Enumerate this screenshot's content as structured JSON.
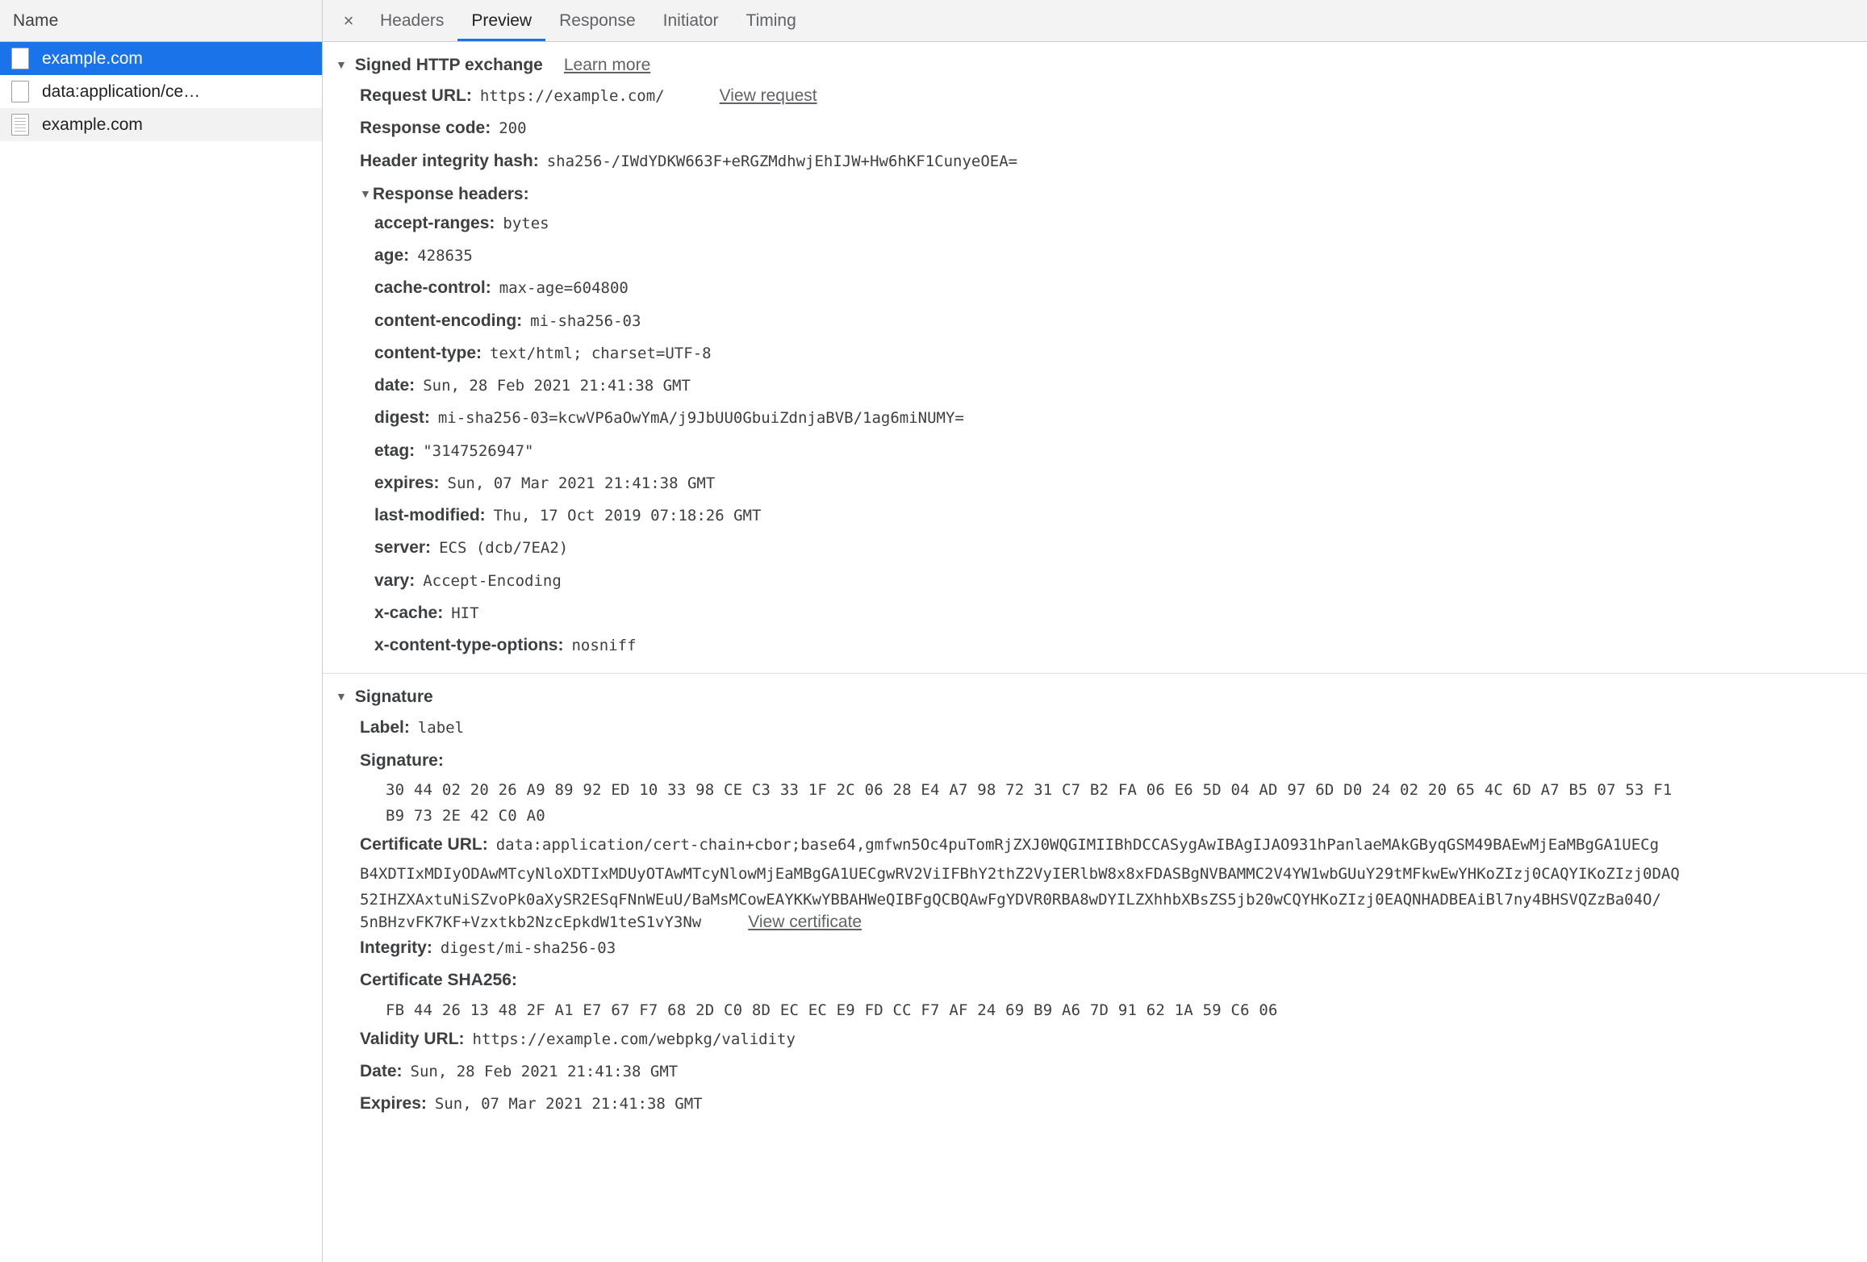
{
  "sidebar": {
    "column_header": "Name",
    "rows": [
      {
        "label": "example.com",
        "icon": "page-icon",
        "selected": true
      },
      {
        "label": "data:application/ce…",
        "icon": "page-icon",
        "selected": false
      },
      {
        "label": "example.com",
        "icon": "document-icon",
        "selected": false
      }
    ]
  },
  "tabs": {
    "close_label": "×",
    "items": [
      {
        "label": "Headers",
        "active": false
      },
      {
        "label": "Preview",
        "active": true
      },
      {
        "label": "Response",
        "active": false
      },
      {
        "label": "Initiator",
        "active": false
      },
      {
        "label": "Timing",
        "active": false
      }
    ]
  },
  "sxg": {
    "title": "Signed HTTP exchange",
    "learn_more": "Learn more",
    "request_url_key": "Request URL:",
    "request_url_val": "https://example.com/",
    "view_request": "View request",
    "response_code_key": "Response code:",
    "response_code_val": "200",
    "header_integrity_key": "Header integrity hash:",
    "header_integrity_val": "sha256-/IWdYDKW663F+eRGZMdhwjEhIJW+Hw6hKF1CunyeOEA=",
    "response_headers_title": "Response headers:",
    "headers": [
      {
        "name": "accept-ranges:",
        "value": "bytes"
      },
      {
        "name": "age:",
        "value": "428635"
      },
      {
        "name": "cache-control:",
        "value": "max-age=604800"
      },
      {
        "name": "content-encoding:",
        "value": "mi-sha256-03"
      },
      {
        "name": "content-type:",
        "value": "text/html; charset=UTF-8"
      },
      {
        "name": "date:",
        "value": "Sun, 28 Feb 2021 21:41:38 GMT"
      },
      {
        "name": "digest:",
        "value": "mi-sha256-03=kcwVP6aOwYmA/j9JbUU0GbuiZdnjaBVB/1ag6miNUMY="
      },
      {
        "name": "etag:",
        "value": "\"3147526947\""
      },
      {
        "name": "expires:",
        "value": "Sun, 07 Mar 2021 21:41:38 GMT"
      },
      {
        "name": "last-modified:",
        "value": "Thu, 17 Oct 2019 07:18:26 GMT"
      },
      {
        "name": "server:",
        "value": "ECS (dcb/7EA2)"
      },
      {
        "name": "vary:",
        "value": "Accept-Encoding"
      },
      {
        "name": "x-cache:",
        "value": "HIT"
      },
      {
        "name": "x-content-type-options:",
        "value": "nosniff"
      }
    ]
  },
  "signature": {
    "title": "Signature",
    "label_key": "Label:",
    "label_val": "label",
    "signature_key": "Signature:",
    "signature_bytes_line1": "30 44 02 20 26 A9 89 92 ED 10 33 98 CE C3 33 1F 2C 06 28 E4 A7 98 72 31 C7 B2 FA 06 E6 5D 04 AD 97 6D D0 24 02 20 65 4C 6D A7 B5 07 53 F1",
    "signature_bytes_line2": "B9 73 2E 42 C0 A0",
    "certificate_url_key": "Certificate URL:",
    "certificate_url_lines": [
      "data:application/cert-chain+cbor;base64,gmfwn5Oc4puTomRjZXJ0WQGIMIIBhDCCASygAwIBAgIJAO931hPanlaeMAkGByqGSM49BAEwMjEaMBgGA1UECg",
      "B4XDTIxMDIyODAwMTcyNloXDTIxMDUyOTAwMTcyNlowMjEaMBgGA1UECgwRV2ViIFBhY2thZ2VyIERlbW8x8xFDASBgNVBAMMC2V4YW1wbGUuY29tMFkwEwYHKoZIzj0CAQYIKoZIzj0DAQ",
      "52IHZXAxtuNiSZvoPk0aXySR2ESqFNnWEuU/BaMsMCowEAYKKwYBBAHWeQIBFgQCBQAwFgYDVR0RBA8wDYILZXhhbXBsZS5jb20wCQYHKoZIzj0EAQNHADBEAiBl7ny4BHSVQZzBa04O/",
      "5nBHzvFK7KF+Vzxtkb2NzcEpkdW1teS1vY3Nw"
    ],
    "view_certificate": "View certificate",
    "integrity_key": "Integrity:",
    "integrity_val": "digest/mi-sha256-03",
    "cert_sha256_key": "Certificate SHA256:",
    "cert_sha256_val": "FB 44 26 13 48 2F A1 E7 67 F7 68 2D C0 8D EC EC E9 FD CC F7 AF 24 69 B9 A6 7D 91 62 1A 59 C6 06",
    "validity_url_key": "Validity URL:",
    "validity_url_val": "https://example.com/webpkg/validity",
    "date_key": "Date:",
    "date_val": "Sun, 28 Feb 2021 21:41:38 GMT",
    "expires_key": "Expires:",
    "expires_val": "Sun, 07 Mar 2021 21:41:38 GMT"
  },
  "colors": {
    "accent": "#1a73e8",
    "selected_row": "#1a73e8",
    "text": "#3c4043",
    "muted": "#5f6368"
  }
}
